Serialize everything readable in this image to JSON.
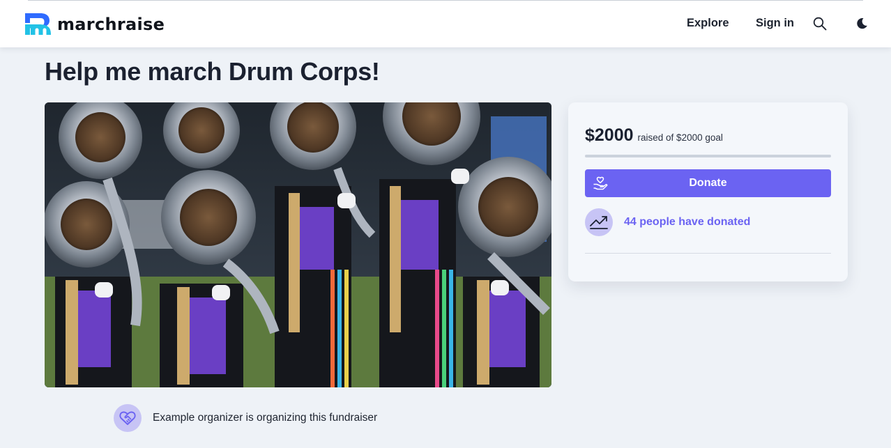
{
  "brand": {
    "name": "marchraise",
    "logo_icon": "marchraise-logo-icon",
    "colors": {
      "top": "#2f6bff",
      "bottom": "#22c2e6"
    }
  },
  "nav": {
    "explore_label": "Explore",
    "signin_label": "Sign in",
    "search_icon": "search-icon",
    "theme_icon": "moon-icon"
  },
  "campaign": {
    "title": "Help me march Drum Corps!",
    "hero_image": "drum-corps-tuba-line-photo",
    "raised_amount": "$2000",
    "raised_text": "raised of $2000 goal",
    "progress_fraction": 1.0,
    "donate_label": "Donate",
    "donate_icon": "hand-heart-icon",
    "donors_text": "44 people have donated",
    "donors_icon": "trending-up-icon",
    "organizer_text": "Example organizer is organizing this fundraiser",
    "organizer_icon": "heart-handshake-icon"
  },
  "colors": {
    "accent": "#6b63f2",
    "accent_soft": "#c7c4f5",
    "page_bg": "#eef2f7",
    "card_bg": "#f4f7fb"
  }
}
